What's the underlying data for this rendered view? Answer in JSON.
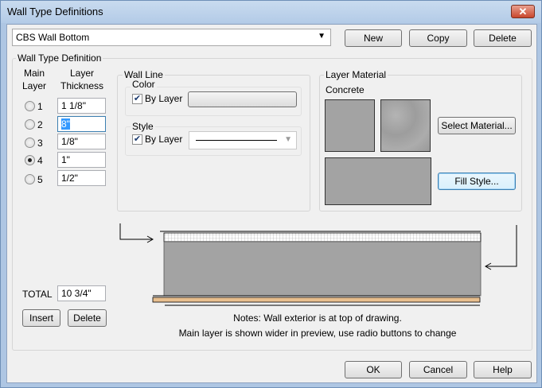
{
  "window": {
    "title": "Wall Type Definitions",
    "close_glyph": "✕"
  },
  "wall_type_select": {
    "value": "CBS Wall Bottom"
  },
  "top_buttons": {
    "new": "New",
    "copy": "Copy",
    "delete": "Delete"
  },
  "definition_group": {
    "title": "Wall Type Definition"
  },
  "layers": {
    "main_header_1": "Main",
    "main_header_2": "Layer",
    "thickness_header_1": "Layer",
    "thickness_header_2": "Thickness",
    "rows": [
      {
        "num": "1",
        "thickness": "1 1/8\"",
        "selected": false
      },
      {
        "num": "2",
        "thickness": "8\"",
        "selected": false
      },
      {
        "num": "3",
        "thickness": "1/8\"",
        "selected": false
      },
      {
        "num": "4",
        "thickness": "1\"",
        "selected": true
      },
      {
        "num": "5",
        "thickness": "1/2\"",
        "selected": false
      }
    ],
    "total_label": "TOTAL",
    "total_value": "10 3/4\"",
    "insert_button": "Insert",
    "delete_button": "Delete"
  },
  "wall_line": {
    "title": "Wall Line",
    "color_label": "Color",
    "color_by_layer": "By Layer",
    "style_label": "Style",
    "style_by_layer": "By Layer"
  },
  "layer_material": {
    "title": "Layer Material",
    "material_name": "Concrete",
    "select_material_button": "Select Material...",
    "fill_style_button": "Fill Style..."
  },
  "notes": {
    "line1": "Notes:  Wall exterior is at top of drawing.",
    "line2": "Main layer is shown wider in preview, use radio buttons to change"
  },
  "bottom_buttons": {
    "ok": "OK",
    "cancel": "Cancel",
    "help": "Help"
  },
  "colors": {
    "concrete": "#a3a3a3",
    "main_layer_band": "#e8bf8f",
    "accent": "#3c7fb1"
  }
}
